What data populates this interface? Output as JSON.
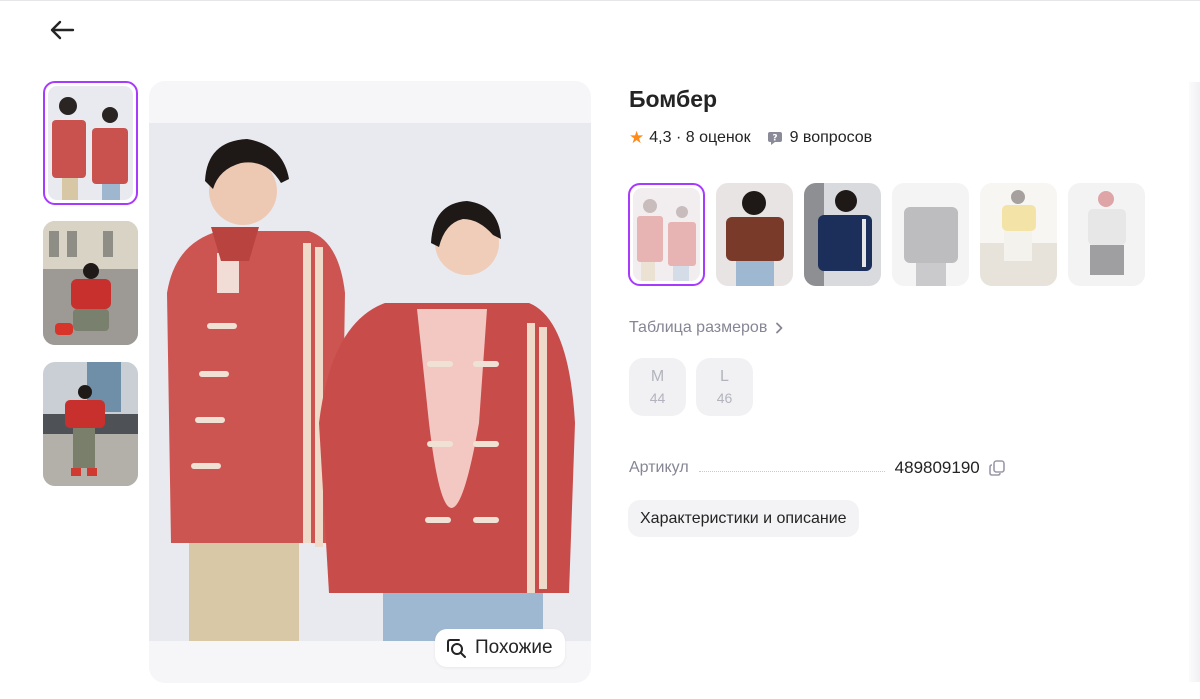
{
  "header": {
    "back_icon": "arrow-left-icon"
  },
  "thumbnails": [
    {
      "name": "thumb-models-red-jackets",
      "selected": true
    },
    {
      "name": "thumb-street-pose",
      "selected": false
    },
    {
      "name": "thumb-outdoor-pose",
      "selected": false
    }
  ],
  "gallery": {
    "similar_label": "Похожие",
    "similar_icon": "image-search-icon"
  },
  "product": {
    "title": "Бомбер",
    "rating": "4,3",
    "rating_separator": " · ",
    "reviews": "8 оценок",
    "questions": "9 вопросов",
    "star_color": "#ff8c1a"
  },
  "colors": [
    {
      "name": "red",
      "selected": true
    },
    {
      "name": "brown",
      "selected": false
    },
    {
      "name": "navy",
      "selected": false
    },
    {
      "name": "grey",
      "selected": false
    },
    {
      "name": "yellow",
      "selected": false
    },
    {
      "name": "light-grey",
      "selected": false
    }
  ],
  "size_table_label": "Таблица размеров",
  "sizes": [
    {
      "label": "M",
      "ru": "44"
    },
    {
      "label": "L",
      "ru": "46"
    }
  ],
  "article": {
    "label": "Артикул",
    "value": "489809190"
  },
  "description_button": "Характеристики и описание",
  "accent_color": "#a73afd"
}
